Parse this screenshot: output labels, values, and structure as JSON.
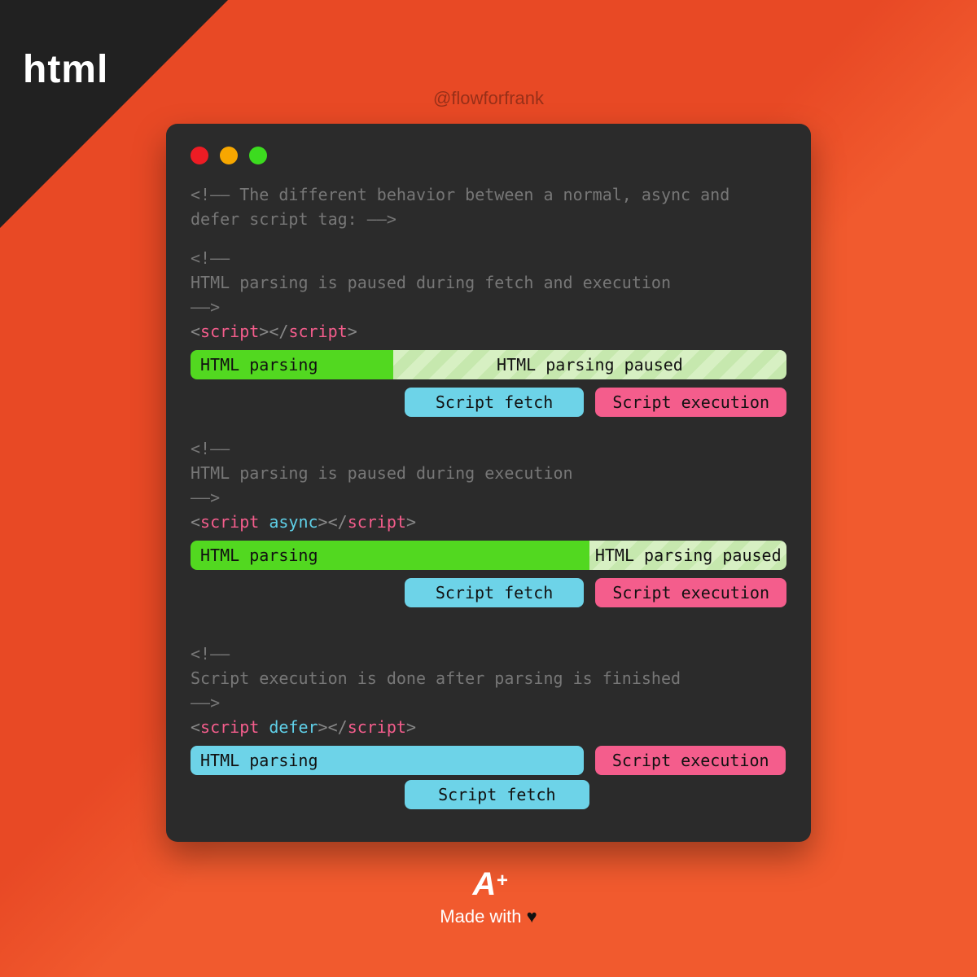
{
  "corner_label": "html",
  "handle": "@flowforfrank",
  "intro_comment": "<!—— The different behavior between a normal, async and defer script tag: ——>",
  "labels": {
    "html_parsing": "HTML parsing",
    "html_parsing_paused": "HTML parsing paused",
    "script_fetch": "Script fetch",
    "script_execution": "Script execution"
  },
  "sections": {
    "normal": {
      "comment_open": "<!——",
      "comment_body": "  HTML parsing is paused during fetch and execution",
      "comment_close": "——>",
      "tag_open_angle": "<",
      "tag_name": "script",
      "tag_close_angle": ">",
      "tag_slash_open": "</",
      "parse_pct": 34,
      "paused_pct": 66,
      "fetch_left_pct": 34,
      "fetch_width_pct": 31,
      "exec_left_pct": 67,
      "exec_width_pct": 33
    },
    "async": {
      "comment_open": "<!——",
      "comment_body": "  HTML parsing is paused during execution",
      "comment_close": "——>",
      "attr": " async",
      "parse_pct": 67,
      "paused_pct": 33,
      "fetch_left_pct": 34,
      "fetch_width_pct": 31,
      "exec_left_pct": 67,
      "exec_width_pct": 33
    },
    "defer": {
      "comment_open": "<!——",
      "comment_body": "  Script execution is done after parsing is finished",
      "comment_close": "——>",
      "attr": " defer",
      "parse_pct": 66,
      "exec_left_pct": 68,
      "exec_width_pct": 32,
      "fetch_left_pct": 34,
      "fetch_width_pct": 31
    }
  },
  "footer": {
    "logo_main": "A",
    "logo_plus": "+",
    "made_prefix": "Made with ",
    "heart": "♥"
  }
}
